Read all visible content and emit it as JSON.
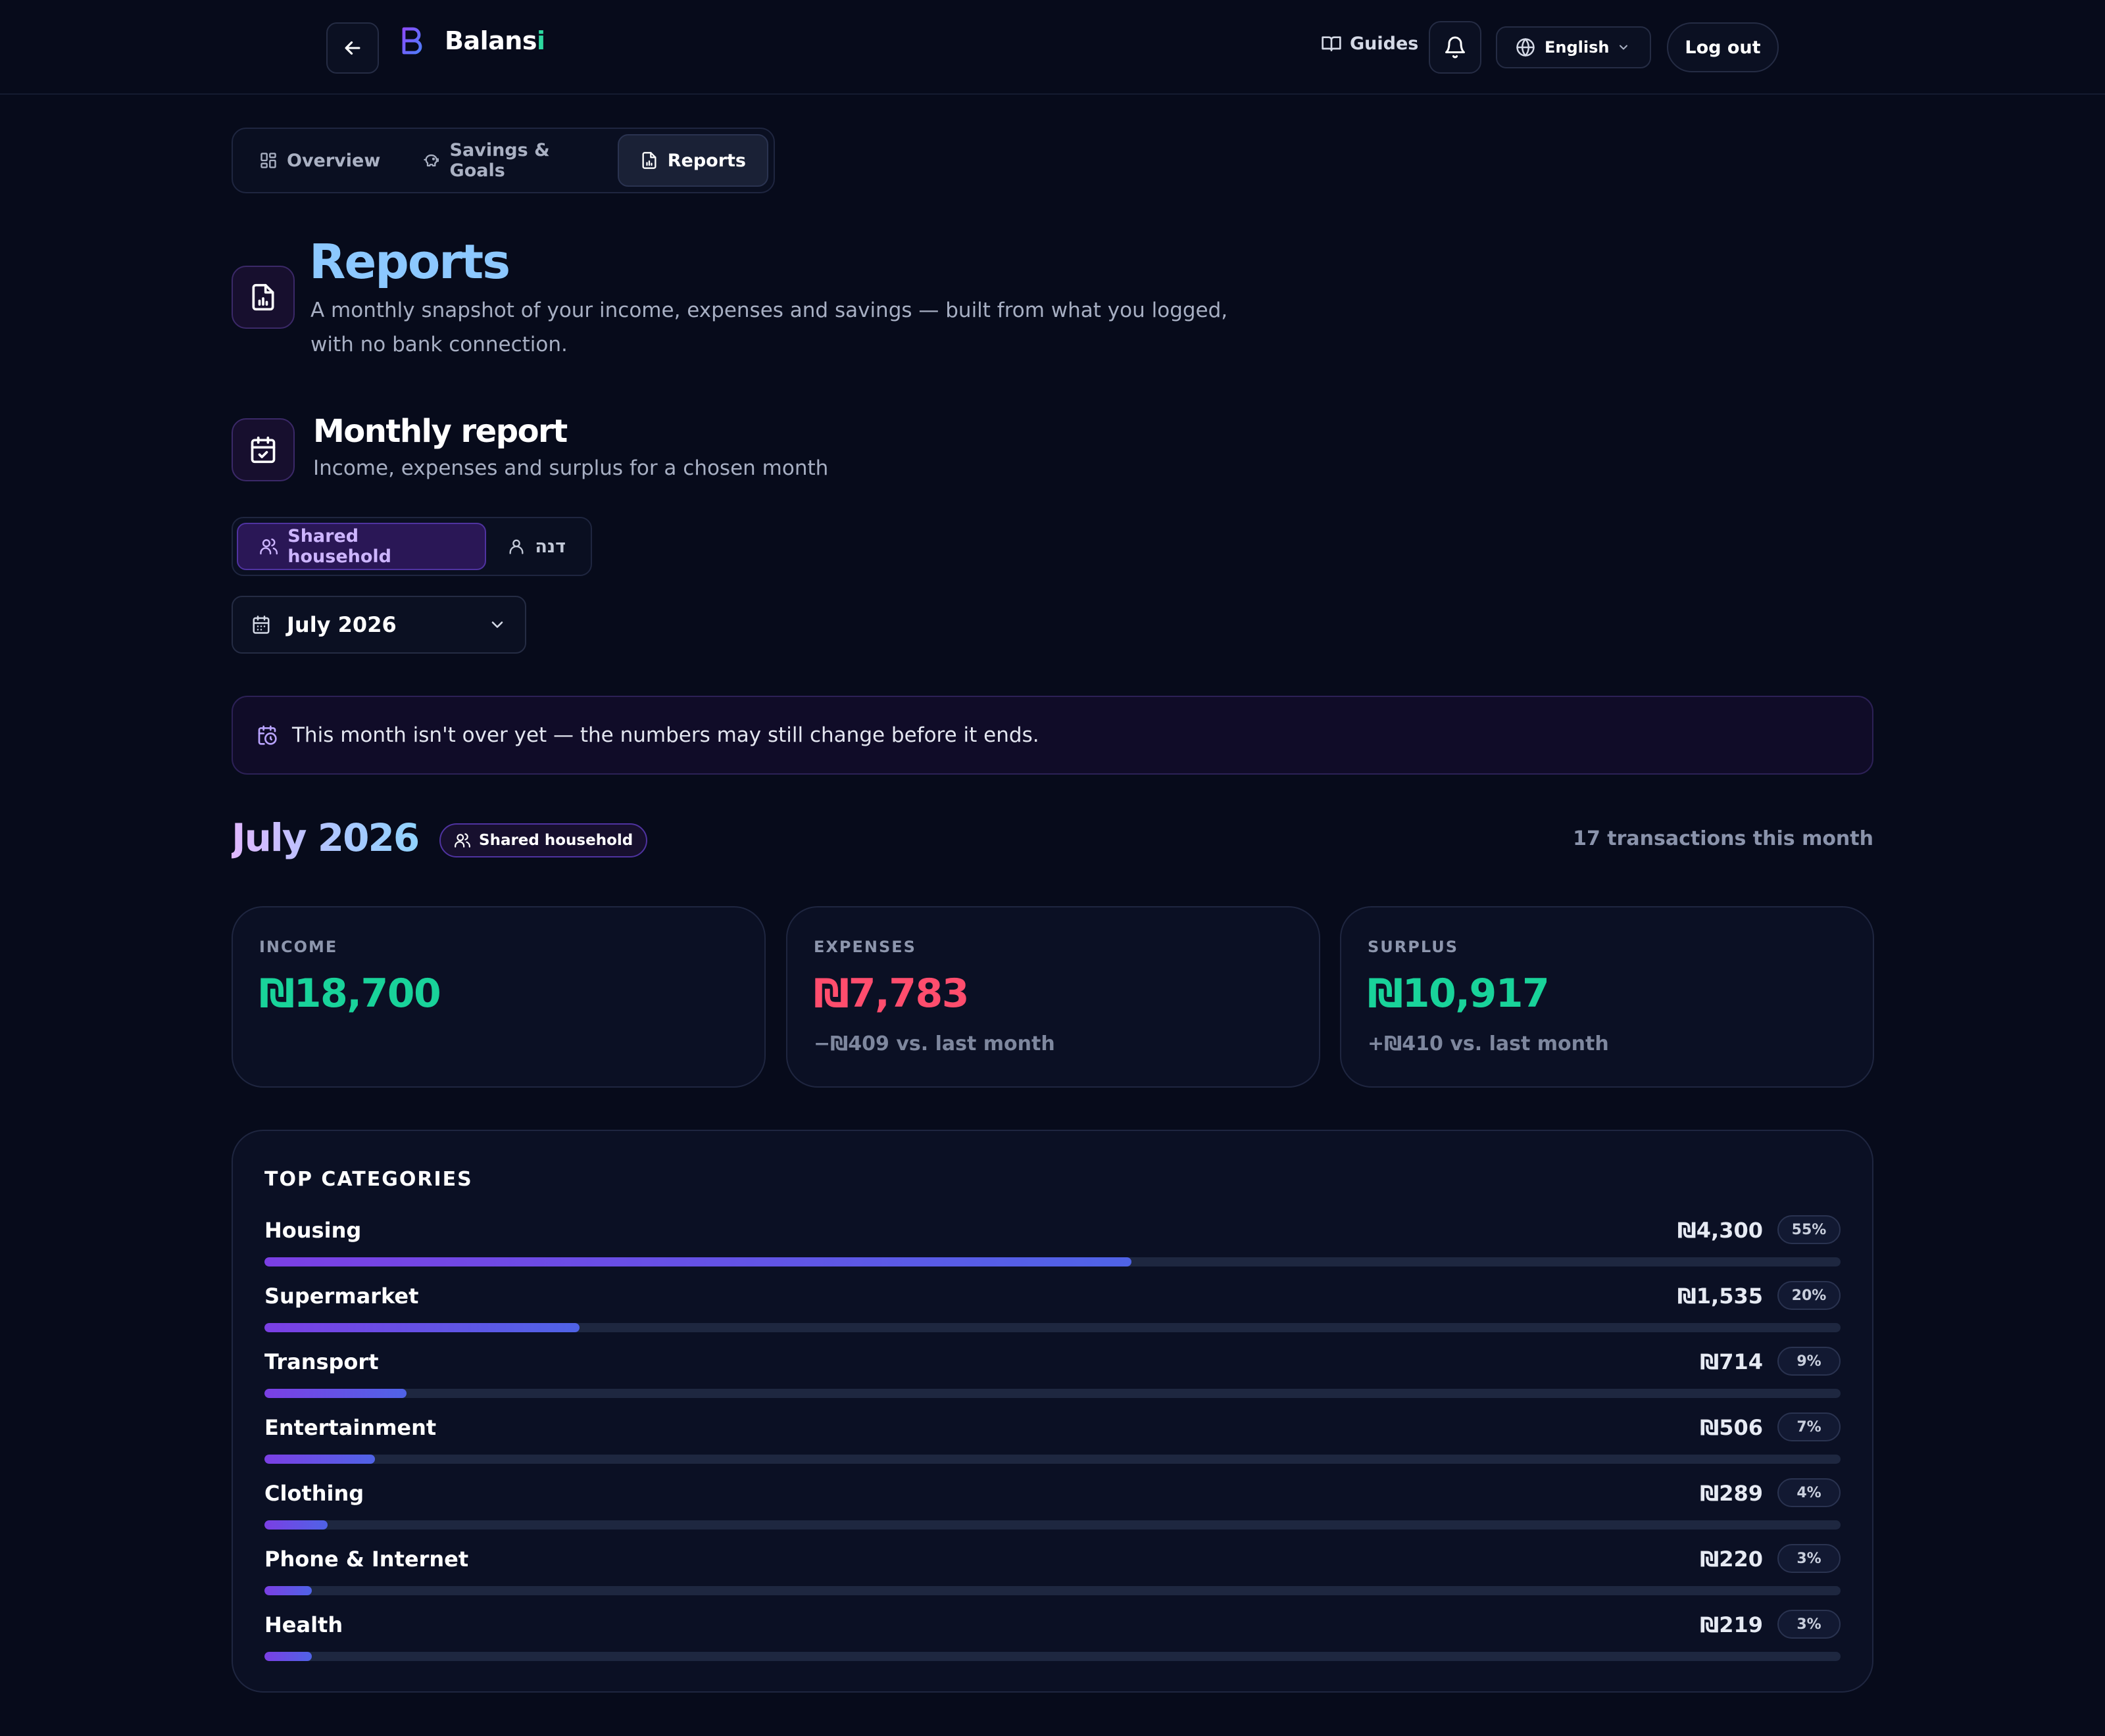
{
  "header": {
    "brand_name_main": "Balans",
    "brand_name_accent": "i",
    "guides_label": "Guides",
    "language_label": "English",
    "logout_label": "Log out"
  },
  "tabs": [
    {
      "label": "Overview",
      "icon": "grid-icon",
      "active": false
    },
    {
      "label": "Savings & Goals",
      "icon": "piggy-bank-icon",
      "active": false
    },
    {
      "label": "Reports",
      "icon": "report-icon",
      "active": true
    }
  ],
  "page": {
    "title": "Reports",
    "description": "A monthly snapshot of your income, expenses and savings — built from what you logged, with no bank connection."
  },
  "monthly_report": {
    "title": "Monthly report",
    "subtitle": "Income, expenses and surplus for a chosen month",
    "scope_options": [
      {
        "label": "Shared household",
        "icon": "users-icon",
        "active": true
      },
      {
        "label": "דנה",
        "icon": "user-icon",
        "active": false
      }
    ],
    "selected_month": "July 2026"
  },
  "notice": "This month isn't over yet — the numbers may still change before it ends.",
  "period": {
    "title": "July 2026",
    "badge": "Shared household",
    "transactions": "17 transactions this month"
  },
  "stats": [
    {
      "label": "INCOME",
      "value": "₪18,700",
      "delta": "",
      "color": "#19d39a"
    },
    {
      "label": "EXPENSES",
      "value": "₪7,783",
      "delta": "−₪409 vs. last month",
      "color": "#ff4d6d"
    },
    {
      "label": "SURPLUS",
      "value": "₪10,917",
      "delta": "+₪410 vs. last month",
      "color": "#19d39a"
    }
  ],
  "top_categories": {
    "heading": "TOP CATEGORIES",
    "items": [
      {
        "name": "Housing",
        "amount": "₪4,300",
        "pct": "55%",
        "share": 0.55
      },
      {
        "name": "Supermarket",
        "amount": "₪1,535",
        "pct": "20%",
        "share": 0.2
      },
      {
        "name": "Transport",
        "amount": "₪714",
        "pct": "9%",
        "share": 0.09
      },
      {
        "name": "Entertainment",
        "amount": "₪506",
        "pct": "7%",
        "share": 0.07
      },
      {
        "name": "Clothing",
        "amount": "₪289",
        "pct": "4%",
        "share": 0.04
      },
      {
        "name": "Phone & Internet",
        "amount": "₪220",
        "pct": "3%",
        "share": 0.03
      },
      {
        "name": "Health",
        "amount": "₪219",
        "pct": "3%",
        "share": 0.03
      }
    ]
  },
  "colors": {
    "accent_purple": "#7b3fe4",
    "accent_blue": "#4f63e6",
    "positive": "#19d39a",
    "negative": "#ff4d6d",
    "title_blue": "#8cc8ff"
  }
}
